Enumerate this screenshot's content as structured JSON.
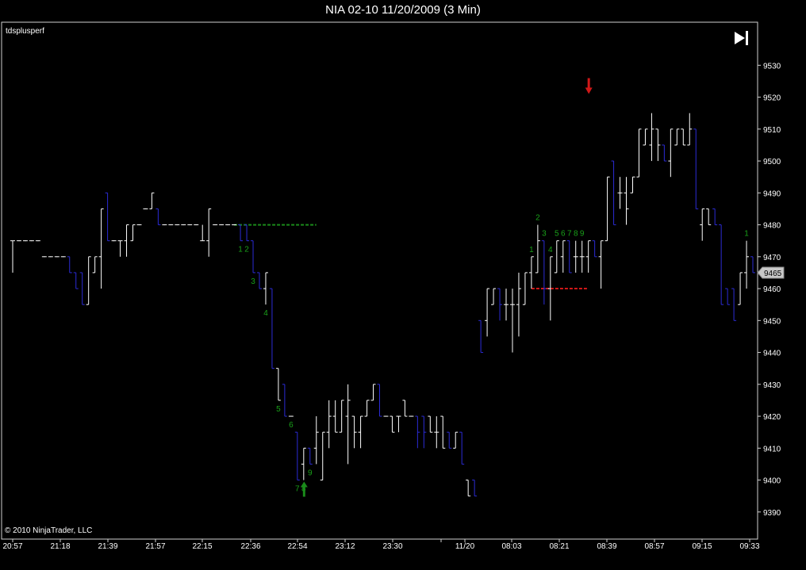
{
  "chart_data": {
    "type": "bar",
    "title": "NIA 02-10  11/20/2009 (3 Min)",
    "indicator": "tdsplusperf",
    "copyright": "© 2010 NinjaTrader, LLC",
    "ylim": [
      9382,
      9543
    ],
    "y_ticks": [
      9530,
      9520,
      9510,
      9500,
      9490,
      9480,
      9470,
      9460,
      9450,
      9440,
      9430,
      9420,
      9410,
      9400,
      9390
    ],
    "current_price": "9465",
    "x_labels": [
      "20:57",
      "21:18",
      "21:39",
      "21:57",
      "22:15",
      "22:36",
      "22:54",
      "23:12",
      "23:30",
      "",
      "11/20",
      "08:03",
      "08:21",
      "08:39",
      "08:57",
      "09:15",
      "09:33"
    ],
    "colors": {
      "up": "#ffffff",
      "down": "#2b2bd6",
      "setup": "#19a019",
      "support": "#1a8a1a",
      "resistance": "#d01818",
      "buy_arrow": "#1a8a1a",
      "sell_arrow": "#d01818"
    },
    "bars": [
      [
        9475,
        9465,
        9475,
        9475,
        "up"
      ],
      [
        9475,
        9475,
        9475,
        9475,
        "up"
      ],
      [
        9475,
        9475,
        9475,
        9475,
        "up"
      ],
      [
        9475,
        9475,
        9475,
        9475,
        "up"
      ],
      [
        9475,
        9475,
        9475,
        9475,
        "up"
      ],
      [
        9470,
        9470,
        9470,
        9470,
        "up"
      ],
      [
        9470,
        9470,
        9470,
        9470,
        "up"
      ],
      [
        9470,
        9470,
        9470,
        9470,
        "up"
      ],
      [
        9470,
        9470,
        9470,
        9470,
        "up"
      ],
      [
        9470,
        9465,
        9470,
        9465,
        "down"
      ],
      [
        9465,
        9460,
        9465,
        9460,
        "down"
      ],
      [
        9465,
        9455,
        9465,
        9455,
        "down"
      ],
      [
        9470,
        9455,
        9455,
        9470,
        "up"
      ],
      [
        9470,
        9465,
        9465,
        9470,
        "up"
      ],
      [
        9485,
        9460,
        9470,
        9485,
        "up"
      ],
      [
        9490,
        9475,
        9490,
        9475,
        "down"
      ],
      [
        9475,
        9475,
        9475,
        9475,
        "up"
      ],
      [
        9475,
        9470,
        9475,
        9475,
        "up"
      ],
      [
        9480,
        9470,
        9475,
        9480,
        "up"
      ],
      [
        9480,
        9475,
        9475,
        9480,
        "up"
      ],
      [
        9480,
        9480,
        9480,
        9480,
        "up"
      ],
      [
        9485,
        9485,
        9485,
        9485,
        "up"
      ],
      [
        9490,
        9485,
        9485,
        9490,
        "up"
      ],
      [
        9485,
        9480,
        9485,
        9480,
        "down"
      ],
      [
        9480,
        9480,
        9480,
        9480,
        "up"
      ],
      [
        9480,
        9480,
        9480,
        9480,
        "up"
      ],
      [
        9480,
        9480,
        9480,
        9480,
        "up"
      ],
      [
        9480,
        9480,
        9480,
        9480,
        "up"
      ],
      [
        9480,
        9480,
        9480,
        9480,
        "up"
      ],
      [
        9480,
        9480,
        9480,
        9480,
        "up"
      ],
      [
        9480,
        9475,
        9475,
        9475,
        "up"
      ],
      [
        9485,
        9470,
        9475,
        9485,
        "up"
      ],
      [
        9480,
        9480,
        9480,
        9480,
        "up"
      ],
      [
        9480,
        9480,
        9480,
        9480,
        "up"
      ],
      [
        9480,
        9480,
        9480,
        9480,
        "up"
      ],
      [
        9480,
        9480,
        9480,
        9480,
        "up"
      ],
      [
        9480,
        9475,
        9480,
        9475,
        "down"
      ],
      [
        9480,
        9475,
        9480,
        9475,
        "down"
      ],
      [
        9475,
        9465,
        9475,
        9465,
        "down"
      ],
      [
        9465,
        9460,
        9465,
        9460,
        "down"
      ],
      [
        9465,
        9455,
        9460,
        9465,
        "up"
      ],
      [
        9460,
        9435,
        9460,
        9435,
        "down"
      ],
      [
        9435,
        9425,
        9435,
        9425,
        "up"
      ],
      [
        9430,
        9420,
        9430,
        9420,
        "down"
      ],
      [
        9420,
        9420,
        9420,
        9420,
        "up"
      ],
      [
        9415,
        9400,
        9415,
        9400,
        "down"
      ],
      [
        9410,
        9400,
        9405,
        9410,
        "up"
      ],
      [
        9410,
        9405,
        9410,
        9405,
        "down"
      ],
      [
        9420,
        9405,
        9410,
        9415,
        "up"
      ],
      [
        9415,
        9400,
        9400,
        9415,
        "up"
      ],
      [
        9425,
        9410,
        9415,
        9420,
        "up"
      ],
      [
        9425,
        9415,
        9420,
        9415,
        "up"
      ],
      [
        9425,
        9415,
        9415,
        9425,
        "up"
      ],
      [
        9430,
        9405,
        9420,
        9425,
        "up"
      ],
      [
        9420,
        9410,
        9420,
        9415,
        "up"
      ],
      [
        9420,
        9410,
        9415,
        9420,
        "up"
      ],
      [
        9425,
        9420,
        9420,
        9425,
        "up"
      ],
      [
        9430,
        9425,
        9425,
        9430,
        "up"
      ],
      [
        9430,
        9420,
        9430,
        9420,
        "down"
      ],
      [
        9420,
        9420,
        9420,
        9420,
        "up"
      ],
      [
        9420,
        9415,
        9420,
        9415,
        "up"
      ],
      [
        9420,
        9415,
        9420,
        9420,
        "up"
      ],
      [
        9425,
        9420,
        9425,
        9420,
        "up"
      ],
      [
        9420,
        9420,
        9420,
        9420,
        "up"
      ],
      [
        9420,
        9410,
        9420,
        9415,
        "down"
      ],
      [
        9420,
        9410,
        9420,
        9415,
        "down"
      ],
      [
        9420,
        9415,
        9420,
        9415,
        "up"
      ],
      [
        9420,
        9410,
        9415,
        9415,
        "up"
      ],
      [
        9420,
        9410,
        9420,
        9410,
        "up"
      ],
      [
        9415,
        9410,
        9415,
        9410,
        "down"
      ],
      [
        9415,
        9410,
        9410,
        9415,
        "up"
      ],
      [
        9415,
        9405,
        9415,
        9405,
        "down"
      ],
      [
        9400,
        9395,
        9400,
        9395,
        "up"
      ],
      [
        9400,
        9395,
        9400,
        9395,
        "down"
      ],
      [
        9450,
        9440,
        9450,
        9440,
        "down"
      ],
      [
        9460,
        9445,
        9450,
        9460,
        "up"
      ],
      [
        9460,
        9455,
        9455,
        9460,
        "up"
      ],
      [
        9460,
        9450,
        9460,
        9455,
        "down"
      ],
      [
        9460,
        9450,
        9455,
        9455,
        "up"
      ],
      [
        9460,
        9440,
        9455,
        9455,
        "up"
      ],
      [
        9465,
        9445,
        9455,
        9460,
        "up"
      ],
      [
        9465,
        9455,
        9455,
        9465,
        "up"
      ],
      [
        9470,
        9460,
        9465,
        9470,
        "up"
      ],
      [
        9480,
        9465,
        9465,
        9475,
        "up"
      ],
      [
        9475,
        9455,
        9475,
        9460,
        "down"
      ],
      [
        9470,
        9450,
        9460,
        9470,
        "up"
      ],
      [
        9475,
        9465,
        9465,
        9475,
        "up"
      ],
      [
        9475,
        9465,
        9470,
        9475,
        "up"
      ],
      [
        9475,
        9465,
        9475,
        9465,
        "down"
      ],
      [
        9475,
        9465,
        9470,
        9470,
        "up"
      ],
      [
        9475,
        9465,
        9470,
        9470,
        "up"
      ],
      [
        9475,
        9465,
        9470,
        9475,
        "up"
      ],
      [
        9475,
        9470,
        9475,
        9470,
        "down"
      ],
      [
        9475,
        9460,
        9470,
        9475,
        "up"
      ],
      [
        9495,
        9475,
        9475,
        9495,
        "up"
      ],
      [
        9500,
        9480,
        9500,
        9480,
        "down"
      ],
      [
        9495,
        9485,
        9490,
        9490,
        "up"
      ],
      [
        9495,
        9480,
        9490,
        9485,
        "up"
      ],
      [
        9495,
        9490,
        9490,
        9495,
        "up"
      ],
      [
        9510,
        9495,
        9495,
        9510,
        "up"
      ],
      [
        9510,
        9505,
        9505,
        9510,
        "up"
      ],
      [
        9515,
        9500,
        9505,
        9510,
        "up"
      ],
      [
        9510,
        9500,
        9510,
        9505,
        "up"
      ],
      [
        9505,
        9500,
        9505,
        9500,
        "down"
      ],
      [
        9510,
        9495,
        9500,
        9510,
        "up"
      ],
      [
        9510,
        9505,
        9505,
        9510,
        "up"
      ],
      [
        9510,
        9505,
        9510,
        9505,
        "up"
      ],
      [
        9515,
        9505,
        9505,
        9510,
        "up"
      ],
      [
        9510,
        9485,
        9510,
        9485,
        "down"
      ],
      [
        9485,
        9475,
        9480,
        9485,
        "up"
      ],
      [
        9485,
        9480,
        9485,
        9480,
        "up"
      ],
      [
        9485,
        9480,
        9485,
        9480,
        "down"
      ],
      [
        9480,
        9455,
        9480,
        9455,
        "down"
      ],
      [
        9460,
        9455,
        9460,
        9455,
        "down"
      ],
      [
        9460,
        9450,
        9460,
        9450,
        "down"
      ],
      [
        9465,
        9455,
        9455,
        9465,
        "up"
      ],
      [
        9475,
        9460,
        9465,
        9470,
        "up"
      ],
      [
        9470,
        9465,
        9470,
        9465,
        "down"
      ]
    ],
    "setup_counts": [
      {
        "bar": 36,
        "text": "1",
        "pos": "below"
      },
      {
        "bar": 37,
        "text": "2",
        "pos": "below"
      },
      {
        "bar": 38,
        "text": "3",
        "pos": "below"
      },
      {
        "bar": 40,
        "text": "4",
        "pos": "below"
      },
      {
        "bar": 42,
        "text": "5",
        "pos": "below"
      },
      {
        "bar": 44,
        "text": "6",
        "pos": "below"
      },
      {
        "bar": 45,
        "text": "7",
        "pos": "below"
      },
      {
        "bar": 46,
        "text": "8",
        "pos": "below"
      },
      {
        "bar": 47,
        "text": "9",
        "pos": "below"
      },
      {
        "bar": 82,
        "text": "1",
        "pos": "above"
      },
      {
        "bar": 83,
        "text": "2",
        "pos": "above"
      },
      {
        "bar": 84,
        "text": "3",
        "pos": "above"
      },
      {
        "bar": 85,
        "text": "4",
        "pos": "above"
      },
      {
        "bar": 86,
        "text": "5",
        "pos": "above"
      },
      {
        "bar": 87,
        "text": "6",
        "pos": "above"
      },
      {
        "bar": 88,
        "text": "7",
        "pos": "above"
      },
      {
        "bar": 89,
        "text": "8",
        "pos": "above"
      },
      {
        "bar": 90,
        "text": "9",
        "pos": "above"
      },
      {
        "bar": 116,
        "text": "1",
        "pos": "above"
      }
    ],
    "levels": [
      {
        "name": "support",
        "y": 9480,
        "from_bar": 35,
        "to_bar": 48
      },
      {
        "name": "resistance",
        "y": 9460,
        "from_bar": 82,
        "to_bar": 91
      }
    ],
    "signals": [
      {
        "type": "buy",
        "bar": 46,
        "y": 9400
      },
      {
        "type": "sell",
        "bar": 91,
        "y": 9521
      }
    ]
  }
}
